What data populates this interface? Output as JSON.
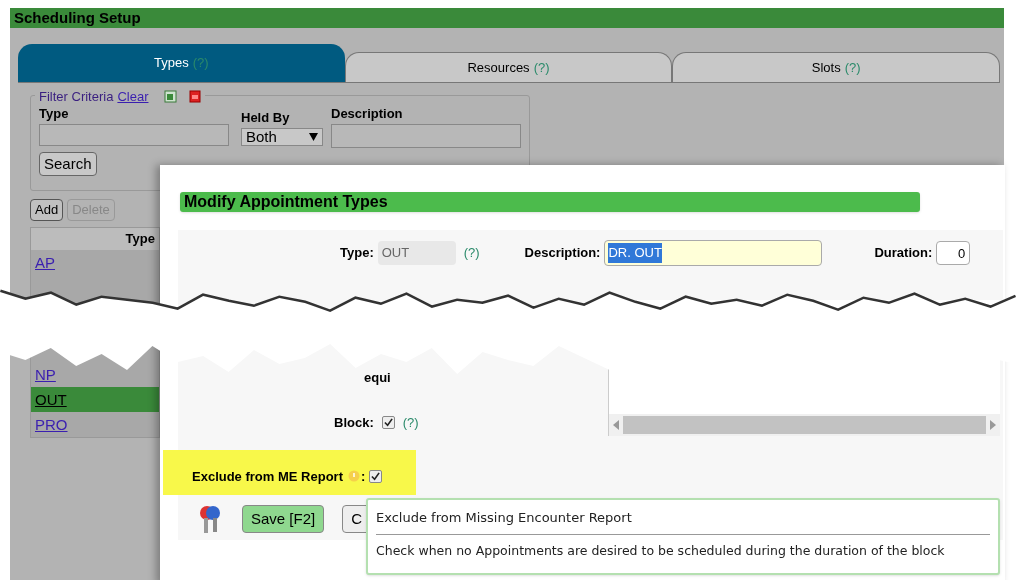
{
  "app": {
    "title": "Scheduling Setup",
    "tabs": [
      {
        "label": "Types",
        "help": "(?)",
        "selected": true
      },
      {
        "label": "Resources",
        "help": "(?)",
        "selected": false
      },
      {
        "label": "Slots",
        "help": "(?)",
        "selected": false
      }
    ],
    "filter": {
      "legend": "Filter Criteria",
      "clear": "Clear",
      "type_label": "Type",
      "held_by_label": "Held By",
      "held_by_value": "Both",
      "description_label": "Description",
      "search": "Search"
    },
    "actions": [
      {
        "label": "Add",
        "disabled": false
      },
      {
        "label": "Delete",
        "disabled": true
      }
    ],
    "list": {
      "header": "Type",
      "items_before_tear": [
        {
          "label": "AP",
          "selected": false
        }
      ],
      "items_after_tear": [
        {
          "label": "NP",
          "selected": false
        },
        {
          "label": "OUT",
          "selected": true
        },
        {
          "label": "PRO",
          "selected": false
        }
      ]
    }
  },
  "dialog": {
    "title": "Modify Appointment Types",
    "type_label": "Type:",
    "type_value": "OUT",
    "type_help": "(?)",
    "description_label": "Description:",
    "description_value": "DR. OUT",
    "duration_label": "Duration:",
    "duration_value": "0",
    "fragment": "equi",
    "block": {
      "label": "Block:",
      "checked": true,
      "help": "(?)"
    },
    "exclude": {
      "label": "Exclude from ME Report",
      "suffix": ":",
      "checked": true,
      "highlighted": true
    },
    "buttons": [
      "Save [F2]",
      "C"
    ]
  },
  "tooltip": {
    "title": "Exclude from Missing Encounter Report",
    "body": "Check when no Appointments are desired to be scheduled during the duration of the block"
  }
}
